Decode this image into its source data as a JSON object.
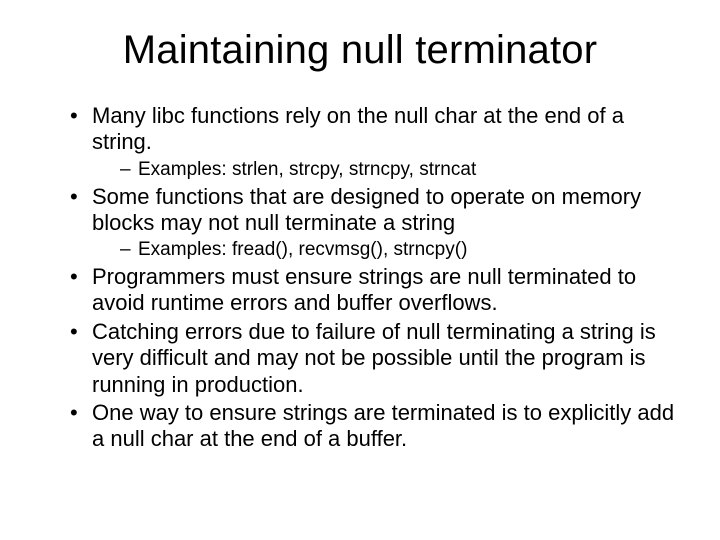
{
  "title": "Maintaining null terminator",
  "bullets": [
    {
      "text": "Many libc functions rely on the null char at the end of a string.",
      "sub": [
        {
          "text": "Examples: strlen, strcpy, strncpy, strncat"
        }
      ]
    },
    {
      "text": "Some functions that are designed to operate on memory blocks may not null terminate a string",
      "sub": [
        {
          "text": "Examples: fread(), recvmsg(), strncpy()"
        }
      ]
    },
    {
      "text": "Programmers must ensure strings are null terminated to avoid runtime errors and buffer overflows.",
      "sub": []
    },
    {
      "text": "Catching errors due to failure of null terminating a string is very difficult and may not be possible until the program is running in production.",
      "sub": []
    },
    {
      "text": "One way to ensure strings are terminated is to explicitly add a null char at the end of a buffer.",
      "sub": []
    }
  ]
}
